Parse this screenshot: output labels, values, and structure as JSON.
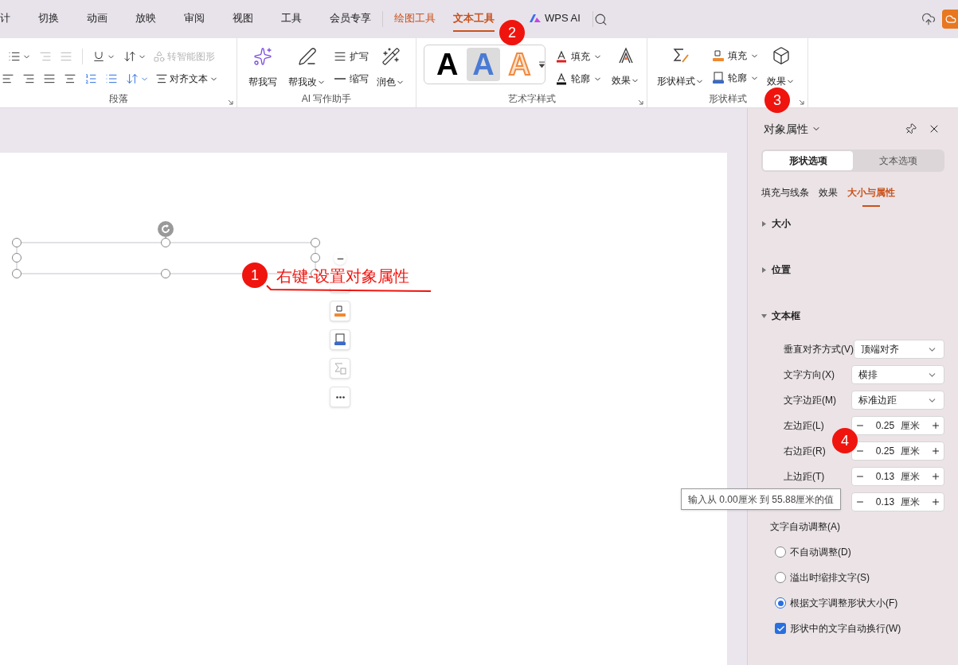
{
  "menu_tabs": [
    {
      "label": "计",
      "kind": "normal",
      "selected": false
    },
    {
      "label": "切换",
      "kind": "normal",
      "selected": false
    },
    {
      "label": "动画",
      "kind": "normal",
      "selected": false
    },
    {
      "label": "放映",
      "kind": "normal",
      "selected": false
    },
    {
      "label": "审阅",
      "kind": "normal",
      "selected": false
    },
    {
      "label": "视图",
      "kind": "normal",
      "selected": false
    },
    {
      "label": "工具",
      "kind": "normal",
      "selected": false
    },
    {
      "label": "会员专享",
      "kind": "normal",
      "selected": false
    },
    {
      "label": "绘图工具",
      "kind": "contextual",
      "selected": false
    },
    {
      "label": "文本工具",
      "kind": "contextual",
      "selected": true
    },
    {
      "label": "WPS AI",
      "kind": "ai",
      "selected": false
    }
  ],
  "ribbon": {
    "paragraph": {
      "title": "段落",
      "items": [
        {
          "label": "转智能图形",
          "disabled": true
        },
        {
          "label": "对齐文本",
          "disabled": false
        }
      ]
    },
    "ai_writing": {
      "title": "AI 写作助手",
      "items": [
        {
          "label": "帮我写",
          "dropdown": false
        },
        {
          "label": "帮我改",
          "dropdown": true
        },
        {
          "label": "扩写",
          "dropdown": false
        },
        {
          "label": "缩写",
          "dropdown": false
        },
        {
          "label": "润色",
          "dropdown": true
        }
      ]
    },
    "wordart": {
      "title": "艺术字样式",
      "styles": [
        {
          "letter": "A",
          "kind": "black",
          "selected": false
        },
        {
          "letter": "A",
          "kind": "blue",
          "selected": true
        },
        {
          "letter": "A",
          "kind": "orange",
          "selected": false
        }
      ],
      "items": [
        {
          "label": "填充"
        },
        {
          "label": "轮廓"
        },
        {
          "label": "效果"
        }
      ]
    },
    "shape_styles": {
      "title": "形状样式",
      "items": [
        {
          "label": "形状样式"
        },
        {
          "label": "填充"
        },
        {
          "label": "轮廓"
        },
        {
          "label": "效果"
        }
      ]
    }
  },
  "panel": {
    "title": "对象属性",
    "tabs": [
      {
        "label": "形状选项",
        "selected": true
      },
      {
        "label": "文本选项",
        "selected": false
      }
    ],
    "subtabs": [
      {
        "label": "填充与线条",
        "selected": false
      },
      {
        "label": "效果",
        "selected": false
      },
      {
        "label": "大小与属性",
        "selected": true
      }
    ],
    "sections": [
      {
        "title": "大小",
        "expanded": false
      },
      {
        "title": "位置",
        "expanded": false
      },
      {
        "title": "文本框",
        "expanded": true,
        "fields": [
          {
            "kind": "dropdown",
            "label": "垂直对齐方式(V)",
            "value": "顶端对齐"
          },
          {
            "kind": "dropdown",
            "label": "文字方向(X)",
            "value": "横排"
          },
          {
            "kind": "dropdown",
            "label": "文字边距(M)",
            "value": "标准边距"
          },
          {
            "kind": "spinner",
            "label": "左边距(L)",
            "value": "0.25",
            "unit": "厘米"
          },
          {
            "kind": "spinner",
            "label": "右边距(R)",
            "value": "0.25",
            "unit": "厘米"
          },
          {
            "kind": "spinner",
            "label": "上边距(T)",
            "value": "0.13",
            "unit": "厘米"
          },
          {
            "kind": "spinner",
            "value": "0.13",
            "unit": "厘米"
          }
        ],
        "autofit": {
          "label": "文字自动调整(A)",
          "options": [
            {
              "label": "不自动调整(D)",
              "selected": false
            },
            {
              "label": "溢出时缩排文字(S)",
              "selected": false
            },
            {
              "label": "根据文字调整形状大小(F)",
              "selected": true
            }
          ]
        },
        "wrap": {
          "label": "形状中的文字自动换行(W)",
          "checked": true
        }
      }
    ]
  },
  "tooltip": "输入从 0.00厘米 到 55.88厘米的值",
  "annotations": [
    {
      "number": "1",
      "text": "右键-设置对象属性"
    },
    {
      "number": "2"
    },
    {
      "number": "3"
    },
    {
      "number": "4"
    }
  ]
}
